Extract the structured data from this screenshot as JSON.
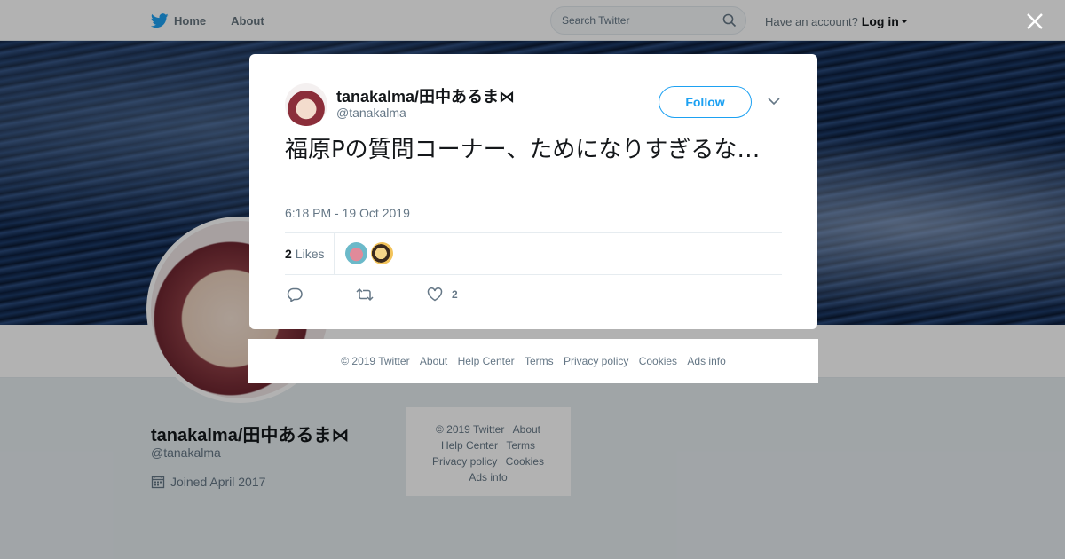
{
  "topbar": {
    "home_label": "Home",
    "about_label": "About",
    "search_placeholder": "Search Twitter",
    "account_prompt": "Have an account?",
    "login_label": "Log in"
  },
  "profile": {
    "name": "tanakalma/田中あるま⋈",
    "handle": "@tanakalma",
    "joined": "Joined April 2017"
  },
  "page_footer": {
    "links": [
      "© 2019 Twitter",
      "About",
      "Help Center",
      "Terms",
      "Privacy policy",
      "Cookies",
      "Ads info"
    ]
  },
  "tweet": {
    "name": "tanakalma/田中あるま⋈",
    "handle": "@tanakalma",
    "follow_label": "Follow",
    "text": "福原Pの質問コーナー、ためになりすぎるな…",
    "timestamp": "6:18 PM - 19 Oct 2019",
    "likes_count": "2",
    "likes_label": "Likes",
    "like_action_count": "2"
  },
  "modal_footer": {
    "links": [
      "© 2019 Twitter",
      "About",
      "Help Center",
      "Terms",
      "Privacy policy",
      "Cookies",
      "Ads info"
    ]
  },
  "colors": {
    "accent": "#1da1f2",
    "muted_text": "#657786",
    "background": "#e6ecf0"
  },
  "icons": [
    "twitter-bird-icon",
    "search-icon",
    "close-icon",
    "chevron-down-icon",
    "reply-icon",
    "retweet-icon",
    "heart-icon",
    "calendar-icon"
  ]
}
